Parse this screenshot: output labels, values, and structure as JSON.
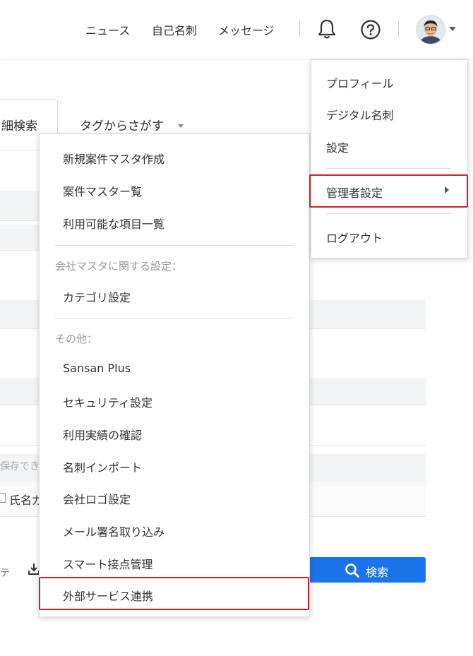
{
  "header": {
    "nav": [
      "ニュース",
      "自己名刺",
      "メッセージ"
    ],
    "icons": [
      "bell-icon",
      "help-icon",
      "avatar-image",
      "chevron-down-icon"
    ]
  },
  "background": {
    "tab_detail_search": "細検索",
    "tag_search": "タグからさがす",
    "save_note": "保存でき",
    "name_option": "氏名ガ",
    "search_button": "検索",
    "tick": "テ"
  },
  "left_menu": {
    "items_top": [
      "新規案件マスタ作成",
      "案件マスター覧",
      "利用可能な項目一覧"
    ],
    "section_company": "会社マスタに関する設定：",
    "company_items": [
      "カテゴリ設定"
    ],
    "section_other": "その他：",
    "other_items": [
      "Sansan Plus",
      "セキュリティ設定",
      "利用実績の確認",
      "名刺インポート",
      "会社ロゴ設定",
      "メール署名取り込み",
      "スマート接点管理",
      "外部サービス連携"
    ],
    "highlighted": "外部サービス連携"
  },
  "right_menu": {
    "items": [
      "プロフィール",
      "デジタル名刺",
      "設定"
    ],
    "admin": "管理者設定",
    "logout": "ログアウト",
    "highlighted": "管理者設定"
  },
  "colors": {
    "primary": "#1a73e8",
    "highlight": "#d0202a"
  }
}
